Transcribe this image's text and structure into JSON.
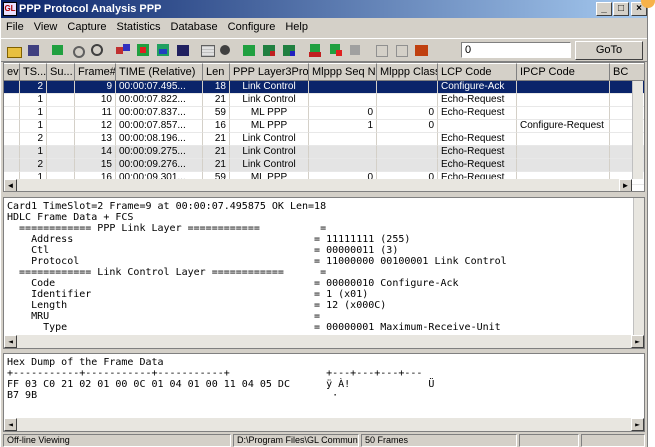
{
  "window": {
    "title": "PPP Protocol Analysis PPP",
    "app_icon": "GL",
    "controls": [
      "_",
      "□",
      "×"
    ]
  },
  "menu": [
    "File",
    "View",
    "Capture",
    "Statistics",
    "Database",
    "Configure",
    "Help"
  ],
  "toolbar": {
    "icons": [
      "open-file-icon",
      "save-icon",
      "filter-icon",
      "capture-icon",
      "stop-icon",
      "network-icon",
      "color-icon",
      "export-icon",
      "print-icon",
      "table-view-icon",
      "record-icon",
      "stats-icon",
      "stats2-icon",
      "stats3-icon",
      "set-icon",
      "filter2-icon",
      "clear-icon",
      "compare-icon",
      "compare2-icon",
      "pdf-icon"
    ],
    "goto_value": "0",
    "goto_label": "GoTo"
  },
  "grid": {
    "columns": [
      "ev",
      "TS...",
      "Su...",
      "Frame#",
      "TIME (Relative)",
      "Len",
      "PPP Layer3Prot...",
      "Mlppp Seq No",
      "Mlppp Class",
      "LCP Code",
      "IPCP Code",
      "BC"
    ],
    "rows": [
      {
        "ev": "",
        "ts": "2",
        "su": "",
        "frame": "9",
        "time": "00:00:07.495...",
        "len": "18",
        "proto": "Link Control",
        "seq": "",
        "cls": "",
        "lcp": "Configure-Ack",
        "ipcp": "",
        "style": "sel"
      },
      {
        "ev": "",
        "ts": "1",
        "su": "",
        "frame": "10",
        "time": "00:00:07.822...",
        "len": "21",
        "proto": "Link Control",
        "seq": "",
        "cls": "",
        "lcp": "Echo-Request",
        "ipcp": "",
        "style": "white"
      },
      {
        "ev": "",
        "ts": "1",
        "su": "",
        "frame": "11",
        "time": "00:00:07.837...",
        "len": "59",
        "proto": "ML PPP",
        "seq": "0",
        "cls": "0",
        "lcp": "Echo-Request",
        "ipcp": "",
        "style": "white"
      },
      {
        "ev": "",
        "ts": "1",
        "su": "",
        "frame": "12",
        "time": "00:00:07.857...",
        "len": "16",
        "proto": "ML PPP",
        "seq": "1",
        "cls": "0",
        "lcp": "",
        "ipcp": "Configure-Request",
        "style": "white"
      },
      {
        "ev": "",
        "ts": "2",
        "su": "",
        "frame": "13",
        "time": "00:00:08.196...",
        "len": "21",
        "proto": "Link Control",
        "seq": "",
        "cls": "",
        "lcp": "Echo-Request",
        "ipcp": "",
        "style": "white"
      },
      {
        "ev": "",
        "ts": "1",
        "su": "",
        "frame": "14",
        "time": "00:00:09.275...",
        "len": "21",
        "proto": "Link Control",
        "seq": "",
        "cls": "",
        "lcp": "Echo-Request",
        "ipcp": "",
        "style": "gray"
      },
      {
        "ev": "",
        "ts": "2",
        "su": "",
        "frame": "15",
        "time": "00:00:09.276...",
        "len": "21",
        "proto": "Link Control",
        "seq": "",
        "cls": "",
        "lcp": "Echo-Request",
        "ipcp": "",
        "style": "gray"
      },
      {
        "ev": "",
        "ts": "1",
        "su": "",
        "frame": "16",
        "time": "00:00:09.301...",
        "len": "59",
        "proto": "ML PPP",
        "seq": "0",
        "cls": "0",
        "lcp": "Echo-Request",
        "ipcp": "",
        "style": "white"
      }
    ]
  },
  "decode": {
    "lines": [
      "Card1 TimeSlot=2 Frame=9 at 00:00:07.495875 OK Len=18",
      "HDLC Frame Data + FCS",
      "  ============ PPP Link Layer ============          =",
      "    Address                                        = 11111111 (255)",
      "    Ctl                                            = 00000011 (3)",
      "    Protocol                                       = 11000000 00100001 Link Control",
      "  ============ Link Control Layer ============      =",
      "    Code                                           = 00000010 Configure-Ack",
      "    Identifier                                     = 1 (x01)",
      "    Length                                         = 12 (x000C)",
      "    MRU                                            =",
      "      Type                                         = 00000001 Maximum-Receive-Unit"
    ]
  },
  "hexdump": {
    "lines": [
      "Hex Dump of the Frame Data",
      "+-----------+-----------+-----------+                +---+---+---+---",
      "FF 03 C0 21 02 01 00 0C 01 04 01 00 11 04 05 DC      ÿ À!             Ü",
      "B7 9B                                                 ·"
    ]
  },
  "status": {
    "mode": "Off-line Viewing",
    "path": "D:\\Program Files\\GL Communicatior",
    "frames": "50 Frames"
  }
}
